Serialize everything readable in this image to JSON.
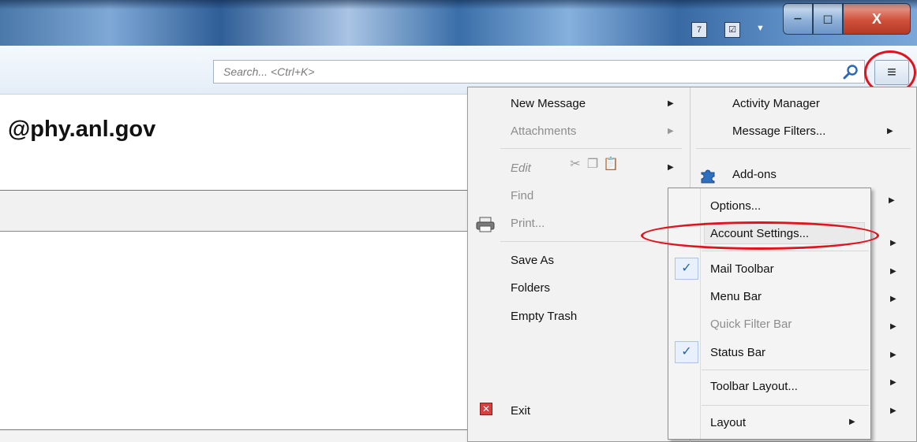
{
  "window": {
    "tray_icons": [
      "calendar-icon",
      "tasks-icon"
    ],
    "tray_calendar_text": "7",
    "buttons": {
      "minimize": "‒",
      "maximize": "◻",
      "close": "X"
    }
  },
  "toolbar": {
    "search_placeholder": "Search... <Ctrl+K>",
    "menu_button": "≡"
  },
  "main": {
    "account_title": "@phy.anl.gov"
  },
  "app_menu": {
    "left": [
      {
        "label": "New Message",
        "disabled": false,
        "submenu": true
      },
      {
        "label": "Attachments",
        "disabled": true,
        "submenu": true
      },
      {
        "label": "Edit",
        "disabled": true,
        "submenu": true
      },
      {
        "label": "Find",
        "disabled": true,
        "submenu": false
      },
      {
        "label": "Print...",
        "disabled": true,
        "submenu": false
      },
      {
        "label": "Save As",
        "disabled": false,
        "submenu": true
      },
      {
        "label": "Folders",
        "disabled": false,
        "submenu": true
      },
      {
        "label": "Empty Trash",
        "disabled": false,
        "submenu": false
      },
      {
        "label": "Exit",
        "disabled": false,
        "submenu": false
      }
    ],
    "right": [
      {
        "label": "Activity Manager",
        "submenu": false
      },
      {
        "label": "Message Filters...",
        "submenu": true
      },
      {
        "label": "Add-ons",
        "submenu": false
      }
    ]
  },
  "options_submenu": {
    "items": [
      {
        "label": "Options...",
        "checked": false,
        "disabled": false,
        "submenu": false
      },
      {
        "label": "Account Settings...",
        "checked": false,
        "disabled": false,
        "submenu": false
      },
      {
        "label": "Mail Toolbar",
        "checked": true,
        "disabled": false,
        "submenu": false
      },
      {
        "label": "Menu Bar",
        "checked": false,
        "disabled": false,
        "submenu": false
      },
      {
        "label": "Quick Filter Bar",
        "checked": false,
        "disabled": true,
        "submenu": false
      },
      {
        "label": "Status Bar",
        "checked": true,
        "disabled": false,
        "submenu": false
      },
      {
        "label": "Toolbar Layout...",
        "checked": false,
        "disabled": false,
        "submenu": false
      },
      {
        "label": "Layout",
        "checked": false,
        "disabled": false,
        "submenu": true
      }
    ],
    "check_glyph": "✓",
    "submenu_arrow": "▶"
  },
  "colors": {
    "annotation": "#e0141e",
    "check": "#2b62a8"
  }
}
